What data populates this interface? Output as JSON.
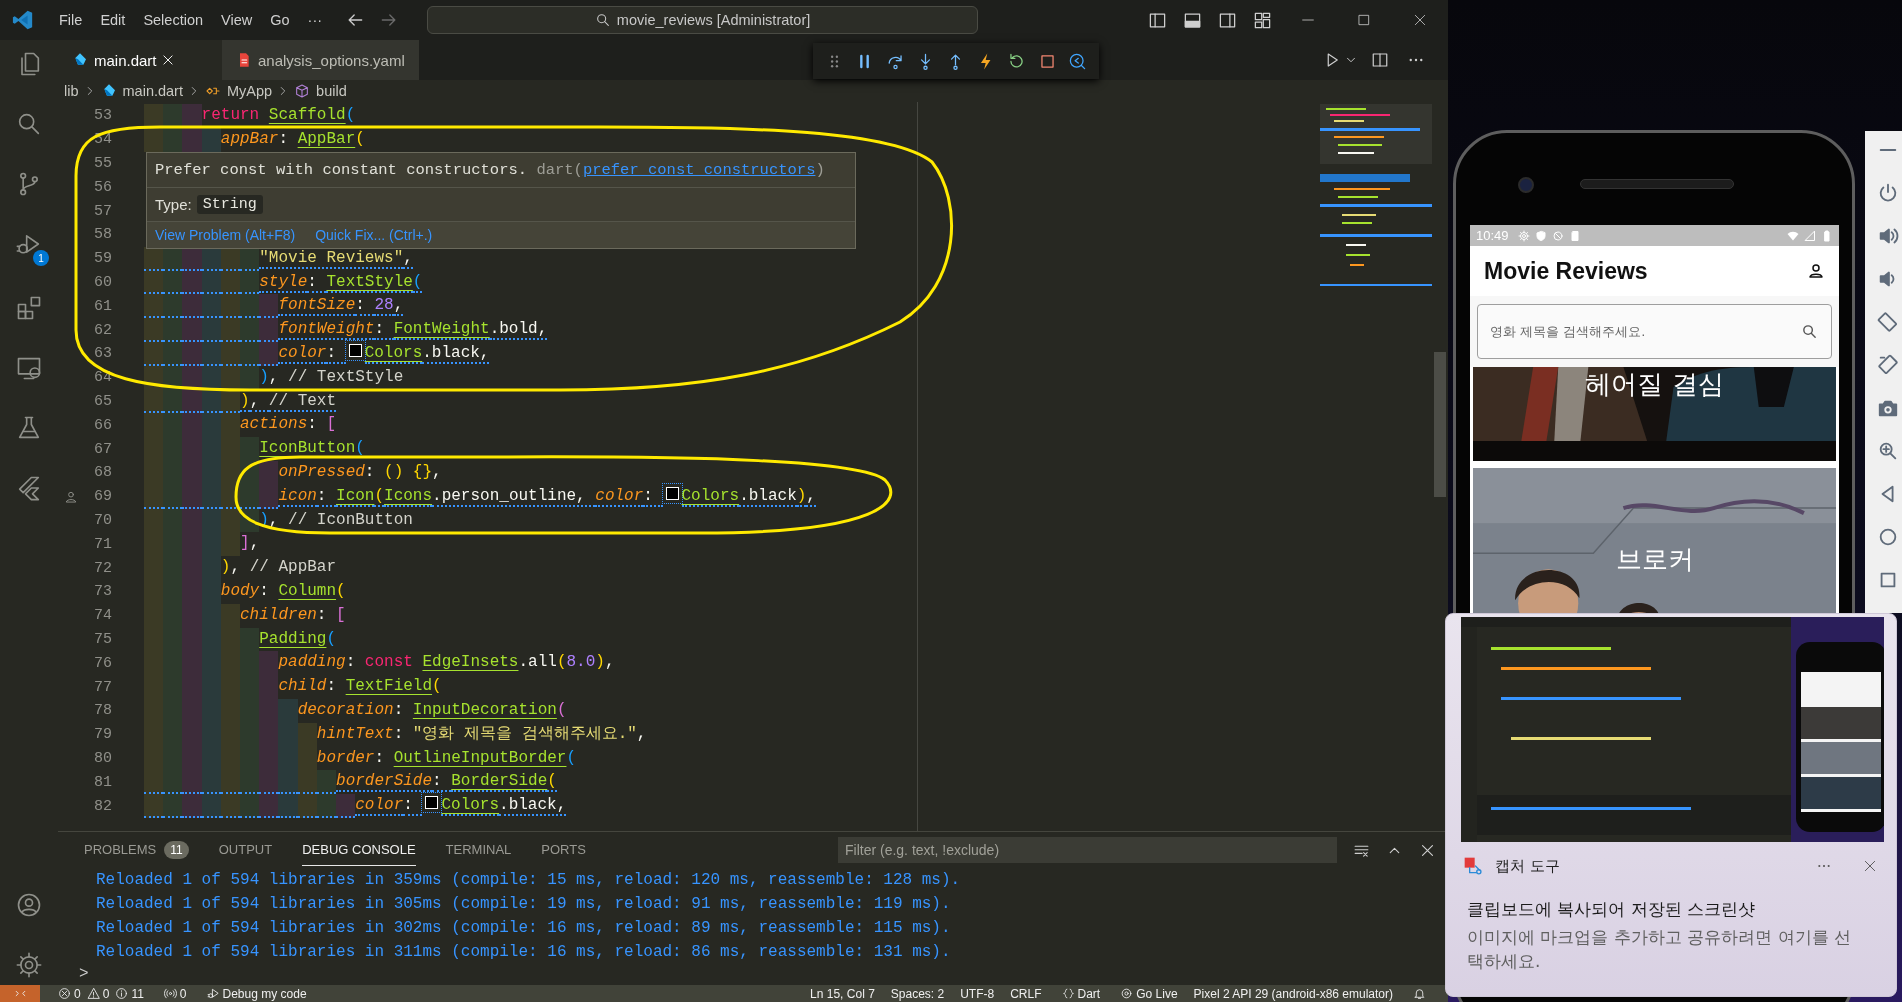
{
  "window": {
    "title": "movie_reviews [Administrator]"
  },
  "menu": [
    "File",
    "Edit",
    "Selection",
    "View",
    "Go",
    "···"
  ],
  "activity_bar": {
    "debug_badge": "1"
  },
  "tabs": [
    {
      "label": "main.dart",
      "selected": true,
      "kind": "dart"
    },
    {
      "label": "analysis_options.yaml",
      "selected": false,
      "kind": "yaml"
    }
  ],
  "breadcrumb": [
    {
      "label": "lib",
      "kind": "folder"
    },
    {
      "label": "main.dart",
      "kind": "dart"
    },
    {
      "label": "MyApp",
      "kind": "class"
    },
    {
      "label": "build",
      "kind": "method"
    }
  ],
  "editor": {
    "lines": [
      {
        "n": "53",
        "warn": false,
        "code": [
          {
            "text": "return ",
            "kind": "kw"
          },
          {
            "text": "Scaffold",
            "kind": "cls"
          },
          {
            "text": "(",
            "kind": "b3"
          }
        ],
        "children": [
          {
            "n": "54",
            "warn": false,
            "code": [
              {
                "text": "appBar",
                "kind": "prm"
              },
              {
                "text": ": ",
                "kind": "txt"
              },
              {
                "text": "AppBar",
                "kind": "cls"
              },
              {
                "text": "(",
                "kind": "b1"
              }
            ],
            "children": [
              {
                "n": "55"
              },
              {
                "n": "56"
              },
              {
                "n": "57"
              },
              {
                "n": "58",
                "children": [
                  {
                    "n": "59",
                    "warn": true,
                    "code": [
                      {
                        "text": "\"Movie Reviews\"",
                        "kind": "str"
                      },
                      {
                        "text": ",",
                        "kind": "txt"
                      }
                    ]
                  },
                  {
                    "n": "60",
                    "warn": true,
                    "code": [
                      {
                        "text": "style",
                        "kind": "prm"
                      },
                      {
                        "text": ": ",
                        "kind": "txt"
                      },
                      {
                        "text": "TextStyle",
                        "kind": "cls"
                      },
                      {
                        "text": "(",
                        "kind": "b3"
                      }
                    ],
                    "children": [
                      {
                        "n": "61",
                        "warn": true,
                        "code": [
                          {
                            "text": "fontSize",
                            "kind": "prm"
                          },
                          {
                            "text": ": ",
                            "kind": "txt"
                          },
                          {
                            "text": "28",
                            "kind": "num"
                          },
                          {
                            "text": ",",
                            "kind": "txt"
                          }
                        ]
                      },
                      {
                        "n": "62",
                        "warn": true,
                        "code": [
                          {
                            "text": "fontWeight",
                            "kind": "prm"
                          },
                          {
                            "text": ": ",
                            "kind": "txt"
                          },
                          {
                            "text": "FontWeight",
                            "kind": "cls"
                          },
                          {
                            "text": ".bold,",
                            "kind": "txt"
                          }
                        ]
                      },
                      {
                        "n": "63",
                        "warn": true,
                        "code": [
                          {
                            "text": "color",
                            "kind": "prm"
                          },
                          {
                            "text": ": ",
                            "kind": "txt"
                          },
                          {
                            "text": "Colors",
                            "kind": "color"
                          },
                          {
                            "text": ".black,",
                            "kind": "txt"
                          }
                        ]
                      }
                    ]
                  },
                  {
                    "n": "64",
                    "warn": false,
                    "code": [
                      {
                        "text": ")",
                        "kind": "b3"
                      },
                      {
                        "text": ", ",
                        "kind": "txt"
                      },
                      {
                        "text": "// TextStyle",
                        "kind": "cmt"
                      }
                    ]
                  }
                ]
              },
              {
                "n": "65",
                "warn": true,
                "code": [
                  {
                    "text": ")",
                    "kind": "b1"
                  },
                  {
                    "text": ", ",
                    "kind": "txt"
                  },
                  {
                    "text": "// Text",
                    "kind": "cmt"
                  }
                ]
              },
              {
                "n": "66",
                "warn": false,
                "code": [
                  {
                    "text": "actions",
                    "kind": "prm"
                  },
                  {
                    "text": ": ",
                    "kind": "txt"
                  },
                  {
                    "text": "[",
                    "kind": "b2"
                  }
                ],
                "children": [
                  {
                    "n": "67",
                    "warn": false,
                    "code": [
                      {
                        "text": "IconButton",
                        "kind": "cls"
                      },
                      {
                        "text": "(",
                        "kind": "b3"
                      }
                    ],
                    "children": [
                      {
                        "n": "68",
                        "warn": false,
                        "code": [
                          {
                            "text": "onPressed",
                            "kind": "prm"
                          },
                          {
                            "text": ": ",
                            "kind": "txt"
                          },
                          {
                            "text": "() {}",
                            "kind": "b1"
                          },
                          {
                            "text": ",",
                            "kind": "txt"
                          }
                        ]
                      },
                      {
                        "n": "69",
                        "warn": true,
                        "gutter_icon": true,
                        "code": [
                          {
                            "text": "icon",
                            "kind": "prm"
                          },
                          {
                            "text": ": ",
                            "kind": "txt"
                          },
                          {
                            "text": "Icon",
                            "kind": "cls"
                          },
                          {
                            "text": "(",
                            "kind": "b1"
                          },
                          {
                            "text": "Icons",
                            "kind": "cls"
                          },
                          {
                            "text": ".person_outline, ",
                            "kind": "txt"
                          },
                          {
                            "text": "color",
                            "kind": "prm"
                          },
                          {
                            "text": ": ",
                            "kind": "txt"
                          },
                          {
                            "text": "Colors",
                            "kind": "color"
                          },
                          {
                            "text": ".black",
                            "kind": "txt"
                          },
                          {
                            "text": ")",
                            "kind": "b1"
                          },
                          {
                            "text": ",",
                            "kind": "txt"
                          }
                        ]
                      }
                    ]
                  },
                  {
                    "n": "70",
                    "warn": false,
                    "code": [
                      {
                        "text": ")",
                        "kind": "b3"
                      },
                      {
                        "text": ", ",
                        "kind": "txt"
                      },
                      {
                        "text": "// IconButton",
                        "kind": "cmt"
                      }
                    ]
                  }
                ]
              },
              {
                "n": "71",
                "warn": false,
                "code": [
                  {
                    "text": "]",
                    "kind": "b2"
                  },
                  {
                    "text": ",",
                    "kind": "txt"
                  }
                ]
              }
            ]
          },
          {
            "n": "72",
            "warn": false,
            "code": [
              {
                "text": ")",
                "kind": "b1"
              },
              {
                "text": ", ",
                "kind": "txt"
              },
              {
                "text": "// AppBar",
                "kind": "cmt"
              }
            ]
          },
          {
            "n": "73",
            "warn": false,
            "code": [
              {
                "text": "body",
                "kind": "prm"
              },
              {
                "text": ": ",
                "kind": "txt"
              },
              {
                "text": "Column",
                "kind": "cls"
              },
              {
                "text": "(",
                "kind": "b1"
              }
            ],
            "children": [
              {
                "n": "74",
                "warn": false,
                "code": [
                  {
                    "text": "children",
                    "kind": "prm"
                  },
                  {
                    "text": ": ",
                    "kind": "txt"
                  },
                  {
                    "text": "[",
                    "kind": "b2"
                  }
                ],
                "children": [
                  {
                    "n": "75",
                    "warn": false,
                    "code": [
                      {
                        "text": "Padding",
                        "kind": "cls"
                      },
                      {
                        "text": "(",
                        "kind": "b3"
                      }
                    ],
                    "children": [
                      {
                        "n": "76",
                        "warn": false,
                        "code": [
                          {
                            "text": "padding",
                            "kind": "prm"
                          },
                          {
                            "text": ": ",
                            "kind": "txt"
                          },
                          {
                            "text": "const ",
                            "kind": "kw"
                          },
                          {
                            "text": "EdgeInsets",
                            "kind": "cls"
                          },
                          {
                            "text": ".all",
                            "kind": "txt"
                          },
                          {
                            "text": "(",
                            "kind": "b1"
                          },
                          {
                            "text": "8.0",
                            "kind": "num"
                          },
                          {
                            "text": ")",
                            "kind": "b1"
                          },
                          {
                            "text": ",",
                            "kind": "txt"
                          }
                        ]
                      },
                      {
                        "n": "77",
                        "warn": false,
                        "code": [
                          {
                            "text": "child",
                            "kind": "prm"
                          },
                          {
                            "text": ": ",
                            "kind": "txt"
                          },
                          {
                            "text": "TextField",
                            "kind": "cls"
                          },
                          {
                            "text": "(",
                            "kind": "b1"
                          }
                        ],
                        "children": [
                          {
                            "n": "78",
                            "warn": false,
                            "code": [
                              {
                                "text": "decoration",
                                "kind": "prm"
                              },
                              {
                                "text": ": ",
                                "kind": "txt"
                              },
                              {
                                "text": "InputDecoration",
                                "kind": "cls"
                              },
                              {
                                "text": "(",
                                "kind": "b2"
                              }
                            ],
                            "children": [
                              {
                                "n": "79",
                                "warn": false,
                                "code": [
                                  {
                                    "text": "hintText",
                                    "kind": "prm"
                                  },
                                  {
                                    "text": ": ",
                                    "kind": "txt"
                                  },
                                  {
                                    "text": "\"영화 제목을 검색해주세요.\"",
                                    "kind": "str"
                                  },
                                  {
                                    "text": ",",
                                    "kind": "txt"
                                  }
                                ]
                              },
                              {
                                "n": "80",
                                "warn": false,
                                "code": [
                                  {
                                    "text": "border",
                                    "kind": "prm"
                                  },
                                  {
                                    "text": ": ",
                                    "kind": "txt"
                                  },
                                  {
                                    "text": "OutlineInputBorder",
                                    "kind": "cls"
                                  },
                                  {
                                    "text": "(",
                                    "kind": "b3"
                                  }
                                ],
                                "children": [
                                  {
                                    "n": "81",
                                    "warn": true,
                                    "code": [
                                      {
                                        "text": "borderSide",
                                        "kind": "prm"
                                      },
                                      {
                                        "text": ": ",
                                        "kind": "txt"
                                      },
                                      {
                                        "text": "BorderSide",
                                        "kind": "cls"
                                      },
                                      {
                                        "text": "(",
                                        "kind": "b1"
                                      }
                                    ],
                                    "children": [
                                      {
                                        "n": "82",
                                        "warn": true,
                                        "code": [
                                          {
                                            "text": "color",
                                            "kind": "prm"
                                          },
                                          {
                                            "text": ": ",
                                            "kind": "txt"
                                          },
                                          {
                                            "text": "Colors",
                                            "kind": "color"
                                          },
                                          {
                                            "text": ".black,",
                                            "kind": "txt"
                                          }
                                        ]
                                      }
                                    ]
                                  }
                                ]
                              }
                            ]
                          }
                        ]
                      }
                    ]
                  }
                ]
              }
            ]
          }
        ]
      }
    ]
  },
  "hover": {
    "message": "Prefer const with constant constructors.",
    "source": "dart(",
    "rule": "prefer_const_constructors",
    "source_close": ")",
    "type_label": "Type:",
    "type": "String",
    "actions": [
      "View Problem (Alt+F8)",
      "Quick Fix... (Ctrl+.)"
    ]
  },
  "panel": {
    "tabs": [
      {
        "label": "PROBLEMS",
        "badge": "11",
        "selected": false
      },
      {
        "label": "OUTPUT",
        "selected": false
      },
      {
        "label": "DEBUG CONSOLE",
        "selected": true
      },
      {
        "label": "TERMINAL",
        "selected": false
      },
      {
        "label": "PORTS",
        "selected": false
      }
    ],
    "filter": {
      "placeholder": "Filter (e.g. text, !exclude)"
    },
    "console": [
      "Reloaded 1 of 594 libraries in 359ms (compile: 15 ms, reload: 120 ms, reassemble: 128 ms).",
      "Reloaded 1 of 594 libraries in 305ms (compile: 19 ms, reload: 91 ms, reassemble: 119 ms).",
      "Reloaded 1 of 594 libraries in 302ms (compile: 16 ms, reload: 89 ms, reassemble: 115 ms).",
      "Reloaded 1 of 594 libraries in 311ms (compile: 16 ms, reload: 86 ms, reassemble: 131 ms)."
    ],
    "prompt": ">"
  },
  "status_bar": {
    "errors": "0",
    "warnings": "0",
    "infos": "11",
    "ports": "0",
    "launch": "Debug my code",
    "items": [
      {
        "label": "Ln 15, Col 7",
        "kind": "text"
      },
      {
        "label": "Spaces: 2",
        "kind": "text"
      },
      {
        "label": "UTF-8",
        "kind": "text"
      },
      {
        "label": "CRLF",
        "kind": "text"
      },
      {
        "label": "Dart",
        "kind": "braces"
      },
      {
        "label": "Go Live",
        "kind": "live"
      },
      {
        "label": "Pixel 2 API 29 (android-x86 emulator)",
        "kind": "text"
      }
    ]
  },
  "phone": {
    "time": "10:49",
    "title": "Movie Reviews",
    "search": {
      "placeholder": "영화 제목을 검색해주세요."
    },
    "movies": [
      {
        "title": "헤어질 결심",
        "kind": "picture"
      },
      {
        "title": "브로커",
        "kind": "picture"
      }
    ]
  },
  "notification": {
    "app": "캡처 도구",
    "title": "클립보드에 복사되어 저장된 스크린샷",
    "body": "이미지에 마크업을 추가하고 공유하려면 여기를 선택하세요."
  }
}
